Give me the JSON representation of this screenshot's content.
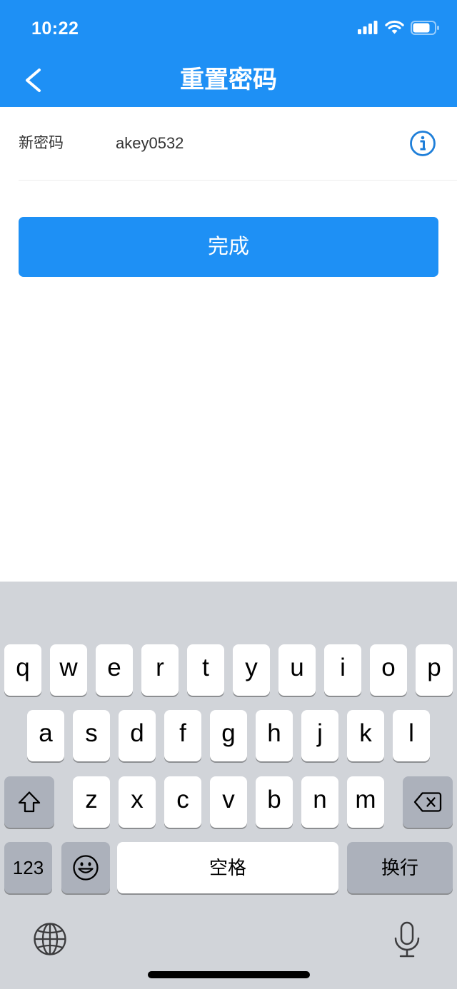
{
  "status_bar": {
    "time": "10:22",
    "icons": [
      "signal-icon",
      "wifi-icon",
      "battery-icon"
    ]
  },
  "header": {
    "title": "重置密码",
    "back_icon": "chevron-left-icon"
  },
  "form": {
    "new_password_label": "新密码",
    "new_password_value": "akey0532",
    "info_icon": "info-circle-icon"
  },
  "submit_button": {
    "label": "完成"
  },
  "keyboard": {
    "row1": [
      "q",
      "w",
      "e",
      "r",
      "t",
      "y",
      "u",
      "i",
      "o",
      "p"
    ],
    "row2": [
      "a",
      "s",
      "d",
      "f",
      "g",
      "h",
      "j",
      "k",
      "l"
    ],
    "row3": [
      "z",
      "x",
      "c",
      "v",
      "b",
      "n",
      "m"
    ],
    "shift_icon": "shift-icon",
    "delete_icon": "backspace-icon",
    "numbers_label": "123",
    "emoji_icon": "emoji-icon",
    "space_label": "空格",
    "return_label": "换行",
    "globe_icon": "globe-icon",
    "mic_icon": "microphone-icon"
  },
  "colors": {
    "accent": "#1E90F5",
    "info_icon": "#1F7FD9",
    "text": "#333333",
    "keyboard_bg": "#D1D4D9",
    "key": "#FFFFFF",
    "function_key": "#ACB1BB"
  }
}
